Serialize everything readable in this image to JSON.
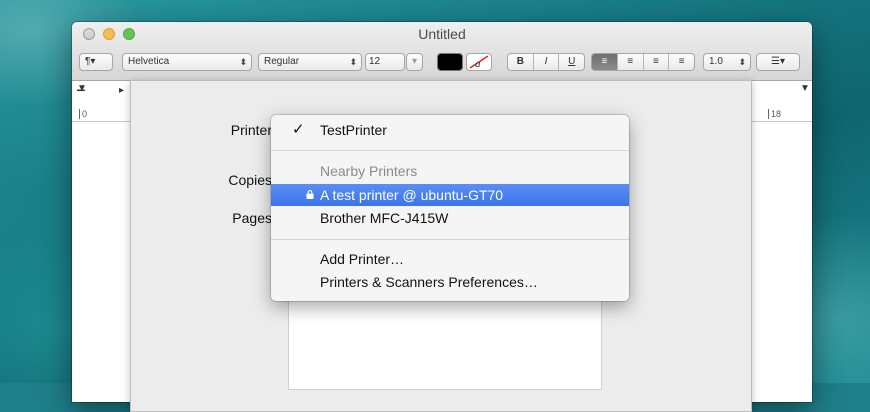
{
  "window": {
    "title": "Untitled"
  },
  "toolbar": {
    "paragraph_styles": "¶▾",
    "font_family": "Helvetica",
    "font_style": "Regular",
    "font_size": "12",
    "bold": "B",
    "italic": "I",
    "underline": "U",
    "line_spacing": "1.0",
    "list_icon": "list-icon"
  },
  "ruler": {
    "left_number": "0",
    "right_number": "18"
  },
  "print_dialog": {
    "printer_label": "Printer",
    "copies_label": "Copies",
    "pages_label": "Pages"
  },
  "printer_menu": {
    "current": "TestPrinter",
    "nearby_header": "Nearby Printers",
    "nearby": [
      "A test printer @ ubuntu-GT70",
      "Brother MFC-J415W"
    ],
    "add_printer": "Add Printer…",
    "preferences": "Printers & Scanners Preferences…",
    "selected_highlight_color": "#3b74ec"
  }
}
